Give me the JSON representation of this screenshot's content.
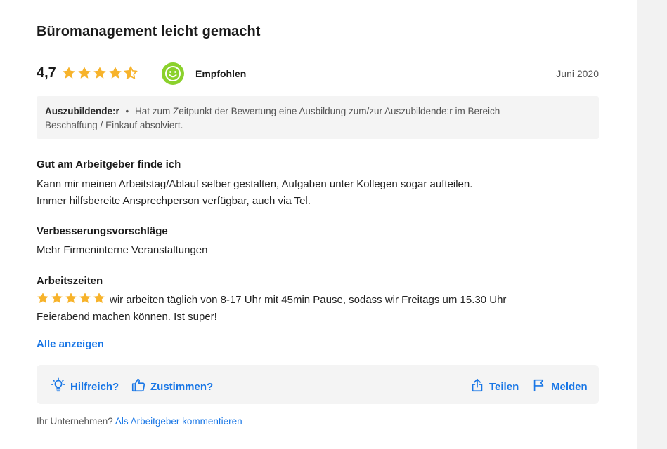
{
  "review": {
    "title": "Büromanagement leicht gemacht",
    "score": "4,7",
    "star_rating": 4.5,
    "recommendation": "Empfohlen",
    "date": "Juni 2020",
    "reviewer": {
      "role": "Auszubildende:r",
      "separator": "•",
      "description": "Hat zum Zeitpunkt der Bewertung eine Ausbildung zum/zur Auszubildende:r im Bereich Beschaffung / Einkauf absolviert."
    },
    "sections": [
      {
        "title": "Gut am Arbeitgeber finde ich",
        "lines": [
          "Kann mir meinen Arbeitstag/Ablauf selber gestalten, Aufgaben unter Kollegen sogar aufteilen.",
          "Immer hilfsbereite Ansprechperson verfügbar, auch via Tel."
        ]
      },
      {
        "title": "Verbesserungsvorschläge",
        "lines": [
          "Mehr Firmeninterne Veranstaltungen"
        ]
      },
      {
        "title": "Arbeitszeiten",
        "stars": 5,
        "lines": [
          "wir arbeiten täglich von 8-17 Uhr mit 45min Pause, sodass wir Freitags um 15.30 Uhr",
          "Feierabend machen können. Ist super!"
        ]
      }
    ],
    "show_all_label": "Alle anzeigen",
    "actions": {
      "helpful": "Hilfreich?",
      "agree": "Zustimmen?",
      "share": "Teilen",
      "report": "Melden"
    },
    "footer": {
      "question": "Ihr Unternehmen?",
      "link": "Als Arbeitgeber kommentieren"
    }
  },
  "colors": {
    "star": "#f7b32b",
    "star_empty": "#dcdcdc",
    "accent": "#1876e6",
    "smiley": "#8bd12c"
  },
  "icons": {
    "star": "star-icon",
    "recommend": "smiley-icon",
    "helpful": "lightbulb-icon",
    "agree": "thumbs-up-icon",
    "share": "share-icon",
    "report": "flag-icon"
  }
}
